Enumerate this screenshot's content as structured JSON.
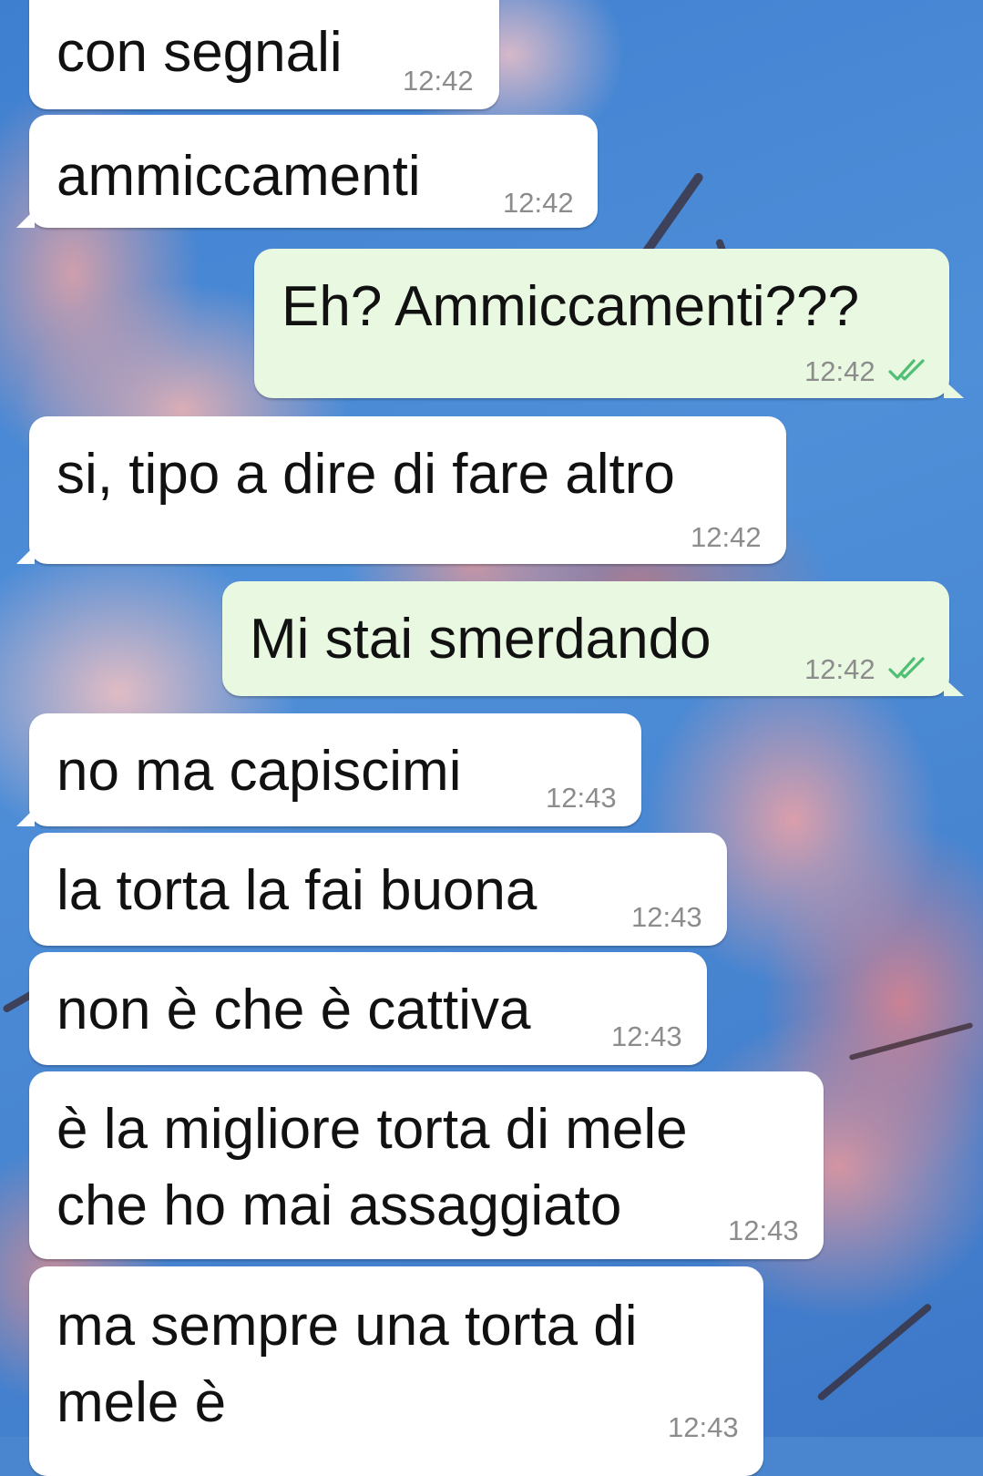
{
  "colors": {
    "incoming_bubble": "#ffffff",
    "outgoing_bubble": "#e9f8e1",
    "message_text": "#111111",
    "timestamp": "#8c8c8c",
    "read_ticks": "#4fbf73"
  },
  "messages": [
    {
      "direction": "incoming",
      "lines": [
        "con segnali"
      ],
      "time": "12:42"
    },
    {
      "direction": "incoming",
      "lines": [
        "ammiccamenti"
      ],
      "time": "12:42"
    },
    {
      "direction": "outgoing",
      "lines": [
        "Eh? Ammiccamenti???"
      ],
      "time": "12:42",
      "status_icon": "double-check-icon"
    },
    {
      "direction": "incoming",
      "lines": [
        "si, tipo a dire di fare altro"
      ],
      "time": "12:42"
    },
    {
      "direction": "outgoing",
      "lines": [
        "Mi stai smerdando"
      ],
      "time": "12:42",
      "status_icon": "double-check-icon"
    },
    {
      "direction": "incoming",
      "lines": [
        "no ma capiscimi"
      ],
      "time": "12:43"
    },
    {
      "direction": "incoming",
      "lines": [
        "la torta la fai buona"
      ],
      "time": "12:43"
    },
    {
      "direction": "incoming",
      "lines": [
        "non è che è cattiva"
      ],
      "time": "12:43"
    },
    {
      "direction": "incoming",
      "lines": [
        "è la migliore torta di mele",
        "che ho mai assaggiato"
      ],
      "time": "12:43"
    },
    {
      "direction": "incoming",
      "lines": [
        "ma sempre una torta di",
        "mele è"
      ],
      "time": "12:43"
    }
  ]
}
